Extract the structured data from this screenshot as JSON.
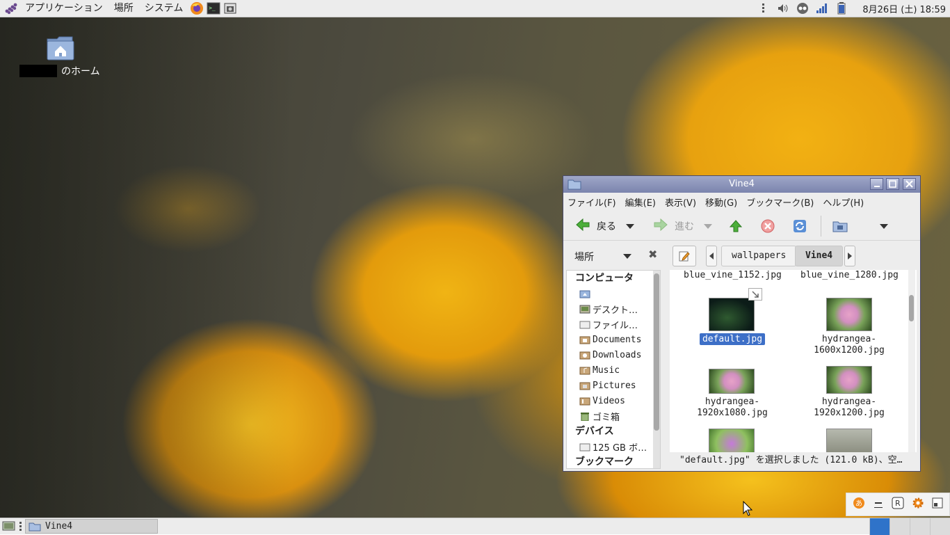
{
  "top_panel": {
    "menus": [
      "アプリケーション",
      "場所",
      "システム"
    ],
    "clock": "8月26日 (土) 18:59"
  },
  "desktop": {
    "home_label": "のホーム"
  },
  "window": {
    "title": "Vine4",
    "menubar": [
      "ファイル(F)",
      "編集(E)",
      "表示(V)",
      "移動(G)",
      "ブックマーク(B)",
      "ヘルプ(H)"
    ],
    "toolbar": {
      "back": "戻る",
      "forward": "進む"
    },
    "location": {
      "places_label": "場所",
      "breadcrumbs": [
        "wallpapers",
        "Vine4"
      ]
    },
    "sidebar": {
      "computer_header": "コンピュータ",
      "items": [
        "デスクト…",
        "ファイル…",
        "Documents",
        "Downloads",
        "Music",
        "Pictures",
        "Videos",
        "ゴミ箱"
      ],
      "devices_header": "デバイス",
      "device_item": "125 GB ボ…",
      "bookmarks_header": "ブックマーク"
    },
    "files": [
      {
        "name": "blue_vine_1152.jpg"
      },
      {
        "name": "blue_vine_1280.jpg"
      },
      {
        "name": "default.jpg",
        "selected": true
      },
      {
        "name_line1": "hydrangea-",
        "name_line2": "1600x1200.jpg"
      },
      {
        "name_line1": "hydrangea-",
        "name_line2": "1920x1080.jpg"
      },
      {
        "name_line1": "hydrangea-",
        "name_line2": "1920x1200.jpg"
      }
    ],
    "status": "\"default.jpg\" を選択しました (121.0 kB)、空…"
  },
  "taskbar": {
    "task_label": "Vine4"
  },
  "colors": {
    "selection": "#3d6fc7",
    "titlebar": "#8a93b8",
    "active_workspace": "#2f73c9"
  }
}
